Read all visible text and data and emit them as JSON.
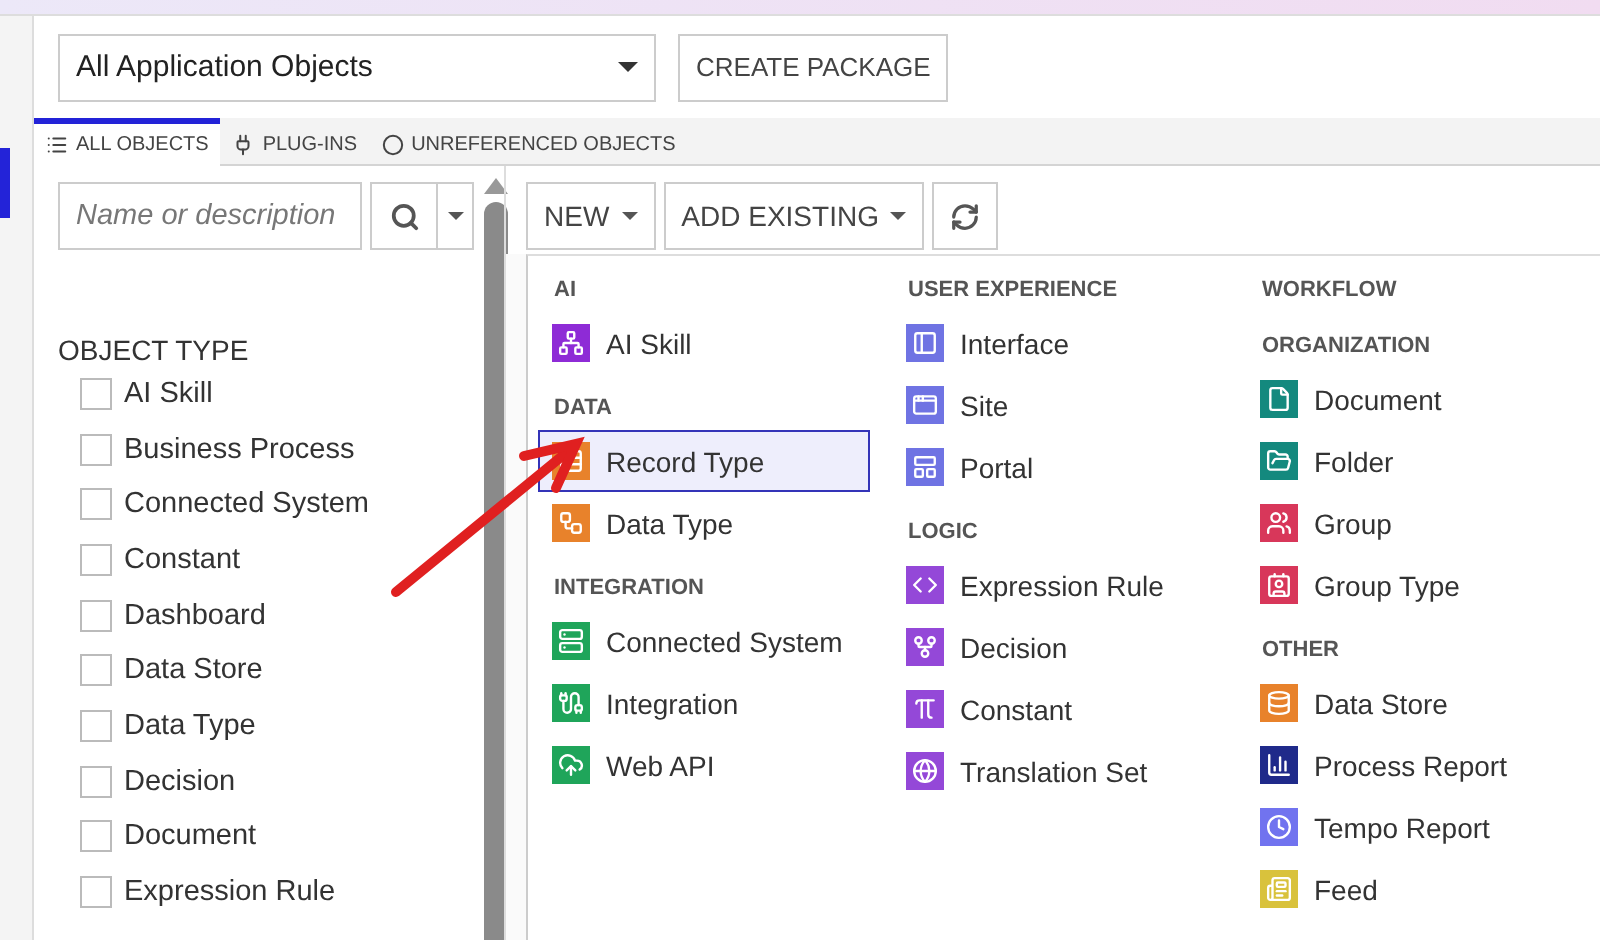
{
  "scope_select": {
    "value": "All Application Objects"
  },
  "create_package_button": "CREATE PACKAGE",
  "tabs": [
    {
      "label": "ALL OBJECTS",
      "kind": "list",
      "selected": true
    },
    {
      "label": "PLUG-INS",
      "kind": "plug",
      "selected": false
    },
    {
      "label": "UNREFERENCED OBJECTS",
      "kind": "circle",
      "selected": false
    }
  ],
  "search": {
    "placeholder": "Name or description"
  },
  "filter": {
    "title": "OBJECT TYPE",
    "items": [
      {
        "label": "AI Skill",
        "checked": false
      },
      {
        "label": "Business Process",
        "checked": false
      },
      {
        "label": "Connected System",
        "checked": false
      },
      {
        "label": "Constant",
        "checked": false
      },
      {
        "label": "Dashboard",
        "checked": false
      },
      {
        "label": "Data Store",
        "checked": false
      },
      {
        "label": "Data Type",
        "checked": false
      },
      {
        "label": "Decision",
        "checked": false
      },
      {
        "label": "Document",
        "checked": false
      },
      {
        "label": "Expression Rule",
        "checked": false
      }
    ]
  },
  "toolbar": {
    "new_button": "NEW",
    "add_existing_button": "ADD EXISTING"
  },
  "new_menu": {
    "columns": [
      [
        {
          "title": "AI",
          "items": [
            {
              "label": "AI Skill",
              "kind": "network",
              "color": "#8e2bd6",
              "selected": false
            }
          ]
        },
        {
          "title": "DATA",
          "items": [
            {
              "label": "Record Type",
              "kind": "rows",
              "color": "#e8822b",
              "selected": true
            },
            {
              "label": "Data Type",
              "kind": "tree",
              "color": "#e8822b",
              "selected": false
            }
          ]
        },
        {
          "title": "INTEGRATION",
          "items": [
            {
              "label": "Connected System",
              "kind": "server",
              "color": "#1fa55a",
              "selected": false
            },
            {
              "label": "Integration",
              "kind": "plug",
              "color": "#1fa55a",
              "selected": false
            },
            {
              "label": "Web API",
              "kind": "cloud",
              "color": "#1fa55a",
              "selected": false
            }
          ]
        }
      ],
      [
        {
          "title": "USER EXPERIENCE",
          "items": [
            {
              "label": "Interface",
              "kind": "panel",
              "color": "#6f73e3",
              "selected": false
            },
            {
              "label": "Site",
              "kind": "window",
              "color": "#6f73e3",
              "selected": false
            },
            {
              "label": "Portal",
              "kind": "layout",
              "color": "#6f73e3",
              "selected": false
            }
          ]
        },
        {
          "title": "LOGIC",
          "items": [
            {
              "label": "Expression Rule",
              "kind": "code",
              "color": "#9448d8",
              "selected": false
            },
            {
              "label": "Decision",
              "kind": "fork",
              "color": "#9448d8",
              "selected": false
            },
            {
              "label": "Constant",
              "kind": "pi",
              "color": "#9448d8",
              "selected": false
            },
            {
              "label": "Translation Set",
              "kind": "globe",
              "color": "#9448d8",
              "selected": false
            }
          ]
        }
      ],
      [
        {
          "title": "WORKFLOW"
        },
        {
          "title": "ORGANIZATION",
          "items": [
            {
              "label": "Document",
              "kind": "file",
              "color": "#14897e",
              "selected": false
            },
            {
              "label": "Folder",
              "kind": "folder",
              "color": "#14897e",
              "selected": false
            },
            {
              "label": "Group",
              "kind": "users",
              "color": "#d8375a",
              "selected": false
            },
            {
              "label": "Group Type",
              "kind": "contact",
              "color": "#d8375a",
              "selected": false
            }
          ]
        },
        {
          "title": "OTHER",
          "items": [
            {
              "label": "Data Store",
              "kind": "database",
              "color": "#e8822b",
              "selected": false
            },
            {
              "label": "Process Report",
              "kind": "chart",
              "color": "#1f2a8a",
              "selected": false
            },
            {
              "label": "Tempo Report",
              "kind": "clock",
              "color": "#7173ef",
              "selected": false
            },
            {
              "label": "Feed",
              "kind": "news",
              "color": "#d9c23c",
              "selected": false
            }
          ]
        }
      ]
    ]
  }
}
